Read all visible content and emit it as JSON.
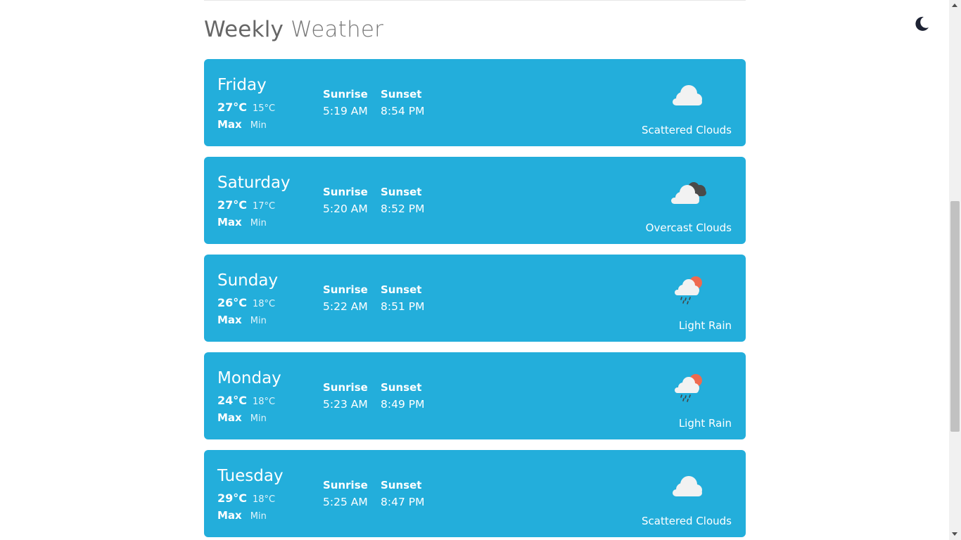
{
  "header": {
    "title_word1": "Weekly",
    "title_word2": "Weather"
  },
  "labels": {
    "sunrise": "Sunrise",
    "sunset": "Sunset",
    "max": "Max",
    "min": "Min"
  },
  "days": [
    {
      "day": "Friday",
      "max": "27°C",
      "min": "15°C",
      "sunrise": "5:19 AM",
      "sunset": "8:54 PM",
      "condition": "Scattered Clouds",
      "icon": "scattered-clouds-icon"
    },
    {
      "day": "Saturday",
      "max": "27°C",
      "min": "17°C",
      "sunrise": "5:20 AM",
      "sunset": "8:52 PM",
      "condition": "Overcast Clouds",
      "icon": "overcast-clouds-icon"
    },
    {
      "day": "Sunday",
      "max": "26°C",
      "min": "18°C",
      "sunrise": "5:22 AM",
      "sunset": "8:51 PM",
      "condition": "Light Rain",
      "icon": "light-rain-icon"
    },
    {
      "day": "Monday",
      "max": "24°C",
      "min": "18°C",
      "sunrise": "5:23 AM",
      "sunset": "8:49 PM",
      "condition": "Light Rain",
      "icon": "light-rain-icon"
    },
    {
      "day": "Tuesday",
      "max": "29°C",
      "min": "18°C",
      "sunrise": "5:25 AM",
      "sunset": "8:47 PM",
      "condition": "Scattered Clouds",
      "icon": "scattered-clouds-icon"
    }
  ],
  "colors": {
    "card": "#23aedb",
    "sun": "#ee6a4f",
    "dark_cloud": "#4a4a4a"
  }
}
